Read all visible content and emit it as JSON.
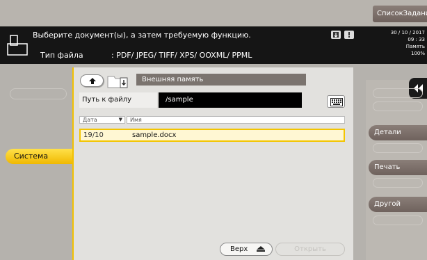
{
  "top": {
    "job_list_label": "СписокЗаданий"
  },
  "header": {
    "message": "Выберите документ(ы), а затем требуемую функцию.",
    "file_type_label": "Тип файла",
    "file_type_value": ": PDF/ JPEG/ TIFF/ XPS/ OOXML/ PPML",
    "date": "30 / 10 / 2017",
    "time": "09 : 33",
    "memory_label": "Память",
    "memory_value": "100%"
  },
  "left": {
    "system_tab_label": "Система"
  },
  "main": {
    "path_title": "Внешняя память",
    "path_label": "Путь к файлу",
    "path_value": "/sample",
    "columns": {
      "date": "Дата",
      "name": "Имя"
    },
    "files": [
      {
        "date": "19/10",
        "name": "sample.docx"
      }
    ],
    "top_button_label": "Верх",
    "open_button_label": "Открыть"
  },
  "right": {
    "details_label": "Детали",
    "print_label": "Печать",
    "other_label": "Другой"
  },
  "colors": {
    "accent": "#f3c500",
    "header_bg": "#151515",
    "action_button": "#7a6e68"
  }
}
